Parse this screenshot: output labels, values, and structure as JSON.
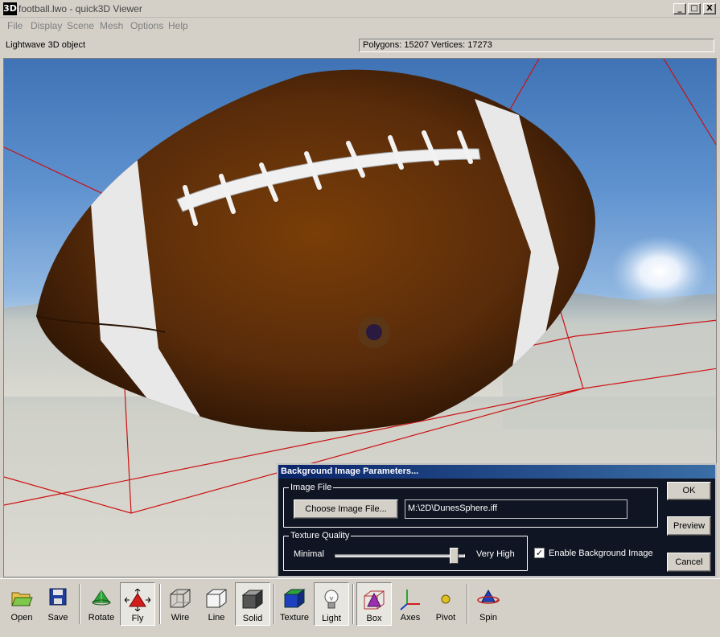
{
  "window": {
    "icon_text": "3D",
    "title": "football.lwo - quick3D Viewer",
    "minimize": "_",
    "maximize": "□",
    "close": "X"
  },
  "menu": [
    "File",
    "Display",
    "Scene",
    "Mesh",
    "Options",
    "Help"
  ],
  "status": {
    "object_type": "Lightwave 3D object",
    "stats": "Polygons: 15207  Vertices: 17273"
  },
  "dialog": {
    "title": "Background Image Parameters...",
    "image_file_group": "Image File",
    "choose_button": "Choose Image File...",
    "file_path": "M:\\2D\\DunesSphere.iff",
    "texture_group": "Texture Quality",
    "min_label": "Minimal",
    "max_label": "Very High",
    "quality_level": 0.95,
    "enable_label": "Enable Background Image",
    "enable_checked": true,
    "check_glyph": "✓",
    "ok": "OK",
    "preview": "Preview",
    "cancel": "Cancel"
  },
  "toolbar": [
    {
      "label": "Open",
      "icon": "open-folder-icon"
    },
    {
      "label": "Save",
      "icon": "floppy-disk-icon"
    },
    {
      "label": "Rotate",
      "icon": "rotate-icon"
    },
    {
      "label": "Fly",
      "icon": "fly-icon",
      "pressed": true
    },
    {
      "label": "Wire",
      "icon": "wireframe-cube-icon"
    },
    {
      "label": "Line",
      "icon": "line-cube-icon"
    },
    {
      "label": "Solid",
      "icon": "solid-cube-icon",
      "pressed": true
    },
    {
      "label": "Texture",
      "icon": "texture-cube-icon"
    },
    {
      "label": "Light",
      "icon": "light-bulb-icon",
      "pressed": true
    },
    {
      "label": "Box",
      "icon": "bounding-box-icon",
      "pressed": true
    },
    {
      "label": "Axes",
      "icon": "axes-icon"
    },
    {
      "label": "Pivot",
      "icon": "pivot-icon"
    },
    {
      "label": "Spin",
      "icon": "spin-icon"
    }
  ]
}
